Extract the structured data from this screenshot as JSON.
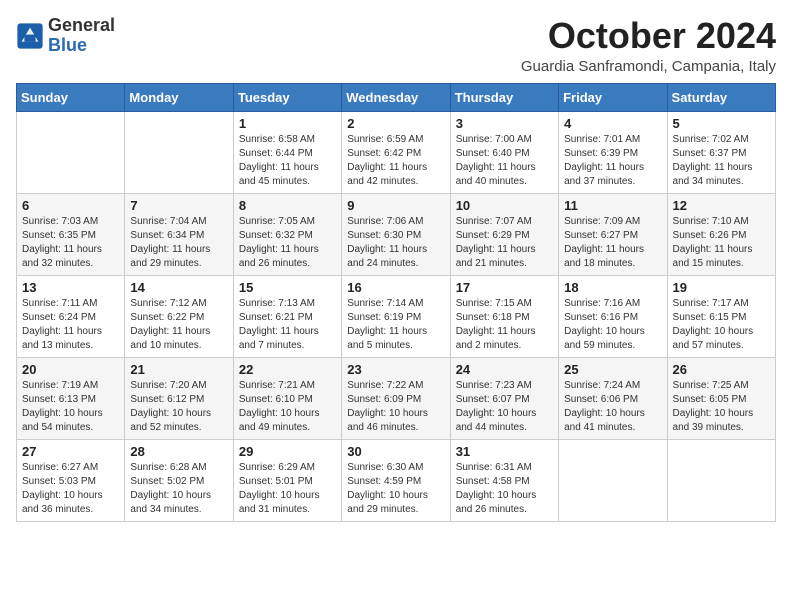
{
  "logo": {
    "general": "General",
    "blue": "Blue"
  },
  "header": {
    "month": "October 2024",
    "location": "Guardia Sanframondi, Campania, Italy"
  },
  "weekdays": [
    "Sunday",
    "Monday",
    "Tuesday",
    "Wednesday",
    "Thursday",
    "Friday",
    "Saturday"
  ],
  "weeks": [
    [
      {
        "day": "",
        "sunrise": "",
        "sunset": "",
        "daylight": ""
      },
      {
        "day": "",
        "sunrise": "",
        "sunset": "",
        "daylight": ""
      },
      {
        "day": "1",
        "sunrise": "Sunrise: 6:58 AM",
        "sunset": "Sunset: 6:44 PM",
        "daylight": "Daylight: 11 hours and 45 minutes."
      },
      {
        "day": "2",
        "sunrise": "Sunrise: 6:59 AM",
        "sunset": "Sunset: 6:42 PM",
        "daylight": "Daylight: 11 hours and 42 minutes."
      },
      {
        "day": "3",
        "sunrise": "Sunrise: 7:00 AM",
        "sunset": "Sunset: 6:40 PM",
        "daylight": "Daylight: 11 hours and 40 minutes."
      },
      {
        "day": "4",
        "sunrise": "Sunrise: 7:01 AM",
        "sunset": "Sunset: 6:39 PM",
        "daylight": "Daylight: 11 hours and 37 minutes."
      },
      {
        "day": "5",
        "sunrise": "Sunrise: 7:02 AM",
        "sunset": "Sunset: 6:37 PM",
        "daylight": "Daylight: 11 hours and 34 minutes."
      }
    ],
    [
      {
        "day": "6",
        "sunrise": "Sunrise: 7:03 AM",
        "sunset": "Sunset: 6:35 PM",
        "daylight": "Daylight: 11 hours and 32 minutes."
      },
      {
        "day": "7",
        "sunrise": "Sunrise: 7:04 AM",
        "sunset": "Sunset: 6:34 PM",
        "daylight": "Daylight: 11 hours and 29 minutes."
      },
      {
        "day": "8",
        "sunrise": "Sunrise: 7:05 AM",
        "sunset": "Sunset: 6:32 PM",
        "daylight": "Daylight: 11 hours and 26 minutes."
      },
      {
        "day": "9",
        "sunrise": "Sunrise: 7:06 AM",
        "sunset": "Sunset: 6:30 PM",
        "daylight": "Daylight: 11 hours and 24 minutes."
      },
      {
        "day": "10",
        "sunrise": "Sunrise: 7:07 AM",
        "sunset": "Sunset: 6:29 PM",
        "daylight": "Daylight: 11 hours and 21 minutes."
      },
      {
        "day": "11",
        "sunrise": "Sunrise: 7:09 AM",
        "sunset": "Sunset: 6:27 PM",
        "daylight": "Daylight: 11 hours and 18 minutes."
      },
      {
        "day": "12",
        "sunrise": "Sunrise: 7:10 AM",
        "sunset": "Sunset: 6:26 PM",
        "daylight": "Daylight: 11 hours and 15 minutes."
      }
    ],
    [
      {
        "day": "13",
        "sunrise": "Sunrise: 7:11 AM",
        "sunset": "Sunset: 6:24 PM",
        "daylight": "Daylight: 11 hours and 13 minutes."
      },
      {
        "day": "14",
        "sunrise": "Sunrise: 7:12 AM",
        "sunset": "Sunset: 6:22 PM",
        "daylight": "Daylight: 11 hours and 10 minutes."
      },
      {
        "day": "15",
        "sunrise": "Sunrise: 7:13 AM",
        "sunset": "Sunset: 6:21 PM",
        "daylight": "Daylight: 11 hours and 7 minutes."
      },
      {
        "day": "16",
        "sunrise": "Sunrise: 7:14 AM",
        "sunset": "Sunset: 6:19 PM",
        "daylight": "Daylight: 11 hours and 5 minutes."
      },
      {
        "day": "17",
        "sunrise": "Sunrise: 7:15 AM",
        "sunset": "Sunset: 6:18 PM",
        "daylight": "Daylight: 11 hours and 2 minutes."
      },
      {
        "day": "18",
        "sunrise": "Sunrise: 7:16 AM",
        "sunset": "Sunset: 6:16 PM",
        "daylight": "Daylight: 10 hours and 59 minutes."
      },
      {
        "day": "19",
        "sunrise": "Sunrise: 7:17 AM",
        "sunset": "Sunset: 6:15 PM",
        "daylight": "Daylight: 10 hours and 57 minutes."
      }
    ],
    [
      {
        "day": "20",
        "sunrise": "Sunrise: 7:19 AM",
        "sunset": "Sunset: 6:13 PM",
        "daylight": "Daylight: 10 hours and 54 minutes."
      },
      {
        "day": "21",
        "sunrise": "Sunrise: 7:20 AM",
        "sunset": "Sunset: 6:12 PM",
        "daylight": "Daylight: 10 hours and 52 minutes."
      },
      {
        "day": "22",
        "sunrise": "Sunrise: 7:21 AM",
        "sunset": "Sunset: 6:10 PM",
        "daylight": "Daylight: 10 hours and 49 minutes."
      },
      {
        "day": "23",
        "sunrise": "Sunrise: 7:22 AM",
        "sunset": "Sunset: 6:09 PM",
        "daylight": "Daylight: 10 hours and 46 minutes."
      },
      {
        "day": "24",
        "sunrise": "Sunrise: 7:23 AM",
        "sunset": "Sunset: 6:07 PM",
        "daylight": "Daylight: 10 hours and 44 minutes."
      },
      {
        "day": "25",
        "sunrise": "Sunrise: 7:24 AM",
        "sunset": "Sunset: 6:06 PM",
        "daylight": "Daylight: 10 hours and 41 minutes."
      },
      {
        "day": "26",
        "sunrise": "Sunrise: 7:25 AM",
        "sunset": "Sunset: 6:05 PM",
        "daylight": "Daylight: 10 hours and 39 minutes."
      }
    ],
    [
      {
        "day": "27",
        "sunrise": "Sunrise: 6:27 AM",
        "sunset": "Sunset: 5:03 PM",
        "daylight": "Daylight: 10 hours and 36 minutes."
      },
      {
        "day": "28",
        "sunrise": "Sunrise: 6:28 AM",
        "sunset": "Sunset: 5:02 PM",
        "daylight": "Daylight: 10 hours and 34 minutes."
      },
      {
        "day": "29",
        "sunrise": "Sunrise: 6:29 AM",
        "sunset": "Sunset: 5:01 PM",
        "daylight": "Daylight: 10 hours and 31 minutes."
      },
      {
        "day": "30",
        "sunrise": "Sunrise: 6:30 AM",
        "sunset": "Sunset: 4:59 PM",
        "daylight": "Daylight: 10 hours and 29 minutes."
      },
      {
        "day": "31",
        "sunrise": "Sunrise: 6:31 AM",
        "sunset": "Sunset: 4:58 PM",
        "daylight": "Daylight: 10 hours and 26 minutes."
      },
      {
        "day": "",
        "sunrise": "",
        "sunset": "",
        "daylight": ""
      },
      {
        "day": "",
        "sunrise": "",
        "sunset": "",
        "daylight": ""
      }
    ]
  ]
}
